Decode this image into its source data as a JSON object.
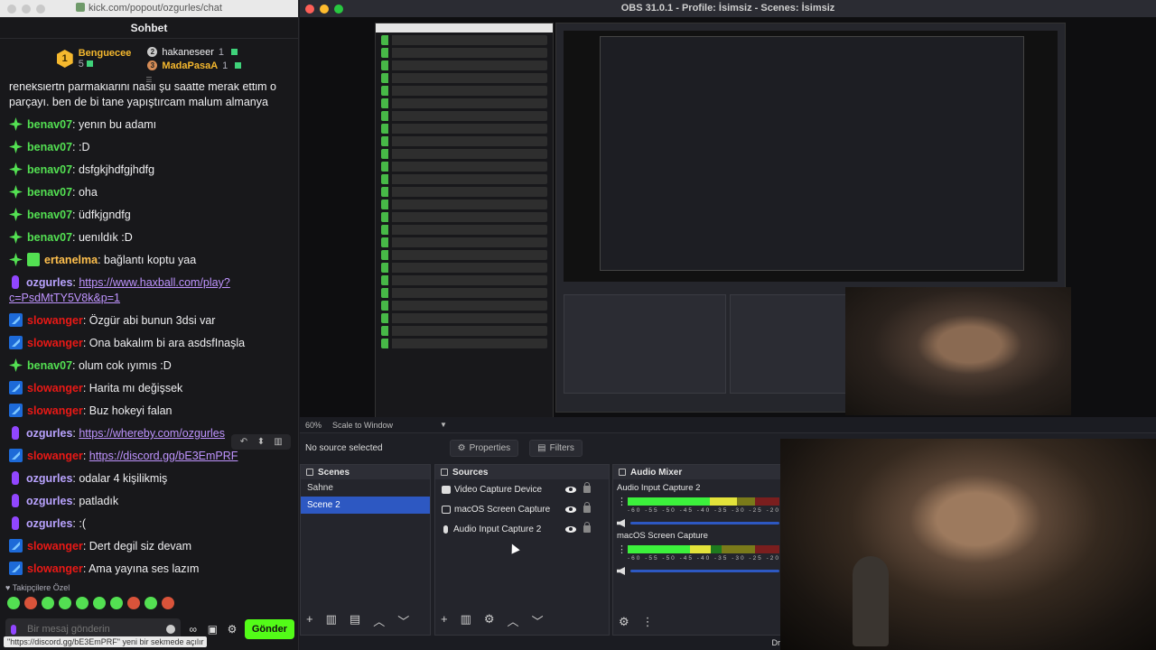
{
  "chat_window": {
    "url": "kick.com/popout/ozgurles/chat",
    "header": "Sohbet",
    "leaderboard": {
      "first": {
        "rank": "1",
        "name": "Benguecee",
        "points": "5"
      },
      "second": {
        "name": "hakaneseer",
        "points": "1"
      },
      "third": {
        "name": "MadaPasaA",
        "points": "1"
      }
    },
    "messages": [
      {
        "badge": "none",
        "user": "",
        "color": "none",
        "text": "reneksiertn parmakiarini nasii şu saatte merak ettim o parçayı. ben de bi tane yapıştırcam malum almanya",
        "link": ""
      },
      {
        "badge": "green",
        "user": "benav07",
        "color": "benav",
        "text": "yenın bu adamı",
        "link": ""
      },
      {
        "badge": "green",
        "user": "benav07",
        "color": "benav",
        "text": ":D",
        "link": ""
      },
      {
        "badge": "green",
        "user": "benav07",
        "color": "benav",
        "text": "dsfgkjhdfgjhdfg",
        "link": ""
      },
      {
        "badge": "green",
        "user": "benav07",
        "color": "benav",
        "text": "oha",
        "link": ""
      },
      {
        "badge": "green",
        "user": "benav07",
        "color": "benav",
        "text": "üdfkjgndfg",
        "link": ""
      },
      {
        "badge": "green",
        "user": "benav07",
        "color": "benav",
        "text": "uenıldık :D",
        "link": ""
      },
      {
        "badge": "green-cake",
        "user": "ertanelma",
        "color": "ert",
        "text": "bağlantı koptu yaa",
        "link": ""
      },
      {
        "badge": "mic",
        "user": "ozgurles",
        "color": "ozg",
        "text": "",
        "link": "https://www.haxball.com/play?c=PsdMtTY5V8k&p=1"
      },
      {
        "badge": "blue",
        "user": "slowanger",
        "color": "slow",
        "text": "Özgür abi bunun 3dsi var",
        "link": ""
      },
      {
        "badge": "blue",
        "user": "slowanger",
        "color": "slow",
        "text": "Ona bakalım bi ara asdsfInaşla",
        "link": ""
      },
      {
        "badge": "green",
        "user": "benav07",
        "color": "benav",
        "text": "olum cok ıyımıs :D",
        "link": ""
      },
      {
        "badge": "blue",
        "user": "slowanger",
        "color": "slow",
        "text": "Harita mı değişsek",
        "link": ""
      },
      {
        "badge": "blue",
        "user": "slowanger",
        "color": "slow",
        "text": "Buz hokeyi falan",
        "link": ""
      },
      {
        "badge": "mic",
        "user": "ozgurles",
        "color": "ozg",
        "text": "",
        "link": "https://whereby.com/ozgurles"
      },
      {
        "badge": "blue",
        "user": "slowanger",
        "color": "slow",
        "text": "",
        "link": "https://discord.gg/bE3EmPRF"
      },
      {
        "badge": "mic",
        "user": "ozgurles",
        "color": "ozg",
        "text": "odalar 4 kişilikmiş",
        "link": ""
      },
      {
        "badge": "mic",
        "user": "ozgurles",
        "color": "ozg",
        "text": "patladık",
        "link": ""
      },
      {
        "badge": "mic",
        "user": "ozgurles",
        "color": "ozg",
        "text": ":(",
        "link": ""
      },
      {
        "badge": "blue",
        "user": "slowanger",
        "color": "slow",
        "text": "Dert degil siz devam",
        "link": ""
      },
      {
        "badge": "blue",
        "user": "slowanger",
        "color": "slow",
        "text": "Ama yayına ses lazım",
        "link": ""
      }
    ],
    "followers_label": "Takipçilere Özel",
    "input_placeholder": "Bir mesaj gönderin",
    "send_label": "Gönder",
    "status_tip": "\"https://discord.gg/bE3EmPRF\" yeni bir sekmede açılır",
    "icons": [
      "undo-icon",
      "pin-icon",
      "trash-icon",
      "smile-icon",
      "infinity-icon",
      "gift-icon",
      "gear-icon"
    ]
  },
  "obs": {
    "title": "OBS 31.0.1 - Profile: İsimsiz - Scenes: İsimsiz",
    "zoom": "60%",
    "scale_mode": "Scale to Window",
    "no_source": "No source selected",
    "properties_label": "Properties",
    "filters_label": "Filters",
    "scenes_title": "Scenes",
    "scenes": [
      {
        "name": "Sahne",
        "selected": false
      },
      {
        "name": "Scene 2",
        "selected": true
      }
    ],
    "sources_title": "Sources",
    "sources": [
      {
        "name": "Video Capture Device",
        "icon": "camera-icon"
      },
      {
        "name": "macOS Screen Capture",
        "icon": "display-icon"
      },
      {
        "name": "Audio Input Capture 2",
        "icon": "mic-icon"
      }
    ],
    "mixer_title": "Audio Mixer",
    "mixer_channels": [
      {
        "name": "Audio Input Capture 2",
        "level": 0.72
      },
      {
        "name": "macOS Screen Capture",
        "level": 0.55
      }
    ],
    "mixer_scale": "-60 -55 -50 -45 -40 -35 -30 -25 -20 -15 -10",
    "status_text": "Dropped Fr"
  }
}
